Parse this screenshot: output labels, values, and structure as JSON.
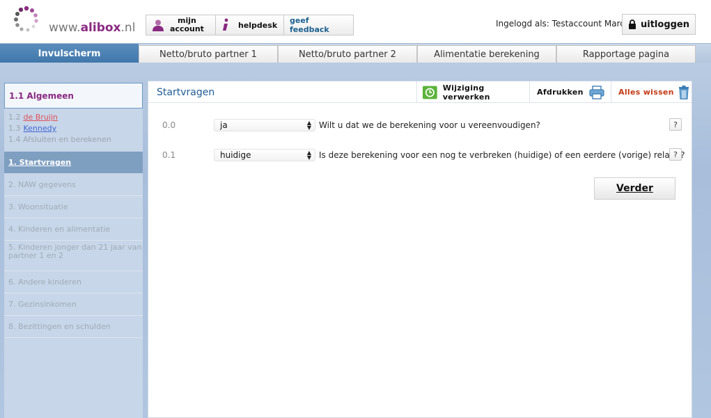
{
  "header": {
    "logo_text": "www.",
    "logo_brand": "alibox",
    "logo_tld": ".nl",
    "nav": {
      "account_line1": "mijn",
      "account_line2": "account",
      "helpdesk": "helpdesk",
      "feedback": "geef feedback"
    },
    "logged_in_text": "Ingelogd als: Testaccount Marcel",
    "logout_label": "uitloggen"
  },
  "tabs": {
    "active": "Invulscherm",
    "items": [
      "Netto/bruto partner 1",
      "Netto/bruto partner 2",
      "Alimentatie berekening",
      "Rapportage pagina"
    ]
  },
  "sidebar": {
    "heading": "1.1 Algemeen",
    "sub": [
      {
        "num": "1.2",
        "link": "de Bruijn"
      },
      {
        "num": "1.3",
        "link": "Kennedy"
      },
      {
        "num": "",
        "text": "1.4 Afsluiten en berekenen"
      }
    ],
    "active_item": "1. Startvragen",
    "items": [
      "2. NAW gegevens",
      "3. Woonsituatie",
      "4. Kinderen en alimentatie",
      "5. Kinderen jonger dan 21 jaar van partner 1 en 2",
      "6. Andere kinderen",
      "7. Gezinsinkomen",
      "8. Bezittingen en schulden"
    ]
  },
  "panel": {
    "title": "Startvragen",
    "btn_wijziging": "Wijziging verwerken",
    "btn_afdrukken": "Afdrukken",
    "btn_wissen": "Alles wissen",
    "questions": [
      {
        "num": "0.0",
        "value": "ja",
        "label": "Wilt u dat we de berekening voor u vereenvoudigen?"
      },
      {
        "num": "0.1",
        "value": "huidige",
        "label": "Is deze berekening voor een nog te verbreken (huidige) of een eerdere (vorige) relatie?"
      }
    ],
    "help_label": "?",
    "verder_label": "Verder"
  },
  "colors": {
    "brand_purple": "#8a2a82",
    "tab_active_blue": "#3f76a9",
    "title_blue": "#1f5c95",
    "wissen_red": "#c33a17",
    "check_green": "#5bb33a"
  },
  "icons": {
    "logo": "dots-ring-logo",
    "account": "user-icon",
    "helpdesk": "info-icon",
    "logout": "lock-icon",
    "wijziging": "clock-check-icon",
    "afdrukken": "printer-icon",
    "wissen": "trash-icon"
  }
}
